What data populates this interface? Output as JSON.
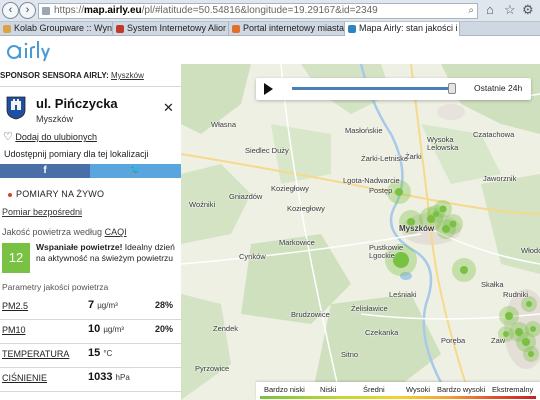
{
  "browser": {
    "url_domain": "map.airly.eu",
    "url_prefix": "https://",
    "url_rest": "/pl/#latitude=50.54816&longitude=19.29167&id=2349",
    "tabs": [
      {
        "label": "Kolab Groupware :: Wyniki wys...",
        "color": "#d9a441"
      },
      {
        "label": "System Internetowy Alior Bank...",
        "color": "#c0392b"
      },
      {
        "label": "Portal internetowy miasta Mys...",
        "color": "#e0702a"
      },
      {
        "label": "Mapa Airly: stan jakości i po...",
        "color": "#2e86c1"
      }
    ]
  },
  "header": {
    "sponsor_label": "SPONSOR SENSORA AIRLY:",
    "sponsor_name": "Myszków"
  },
  "location": {
    "street": "ul. Pińczycka",
    "town": "Myszków",
    "favorite_label": "Dodaj do ulubionych",
    "share_label": "Udostępnij pomiary dla tej lokalizacji",
    "facebook_label": "f",
    "twitter_label": "🐦"
  },
  "live": {
    "heading": "POMIARY NA ŻYWO",
    "direct_link": "Pomiar bezpośredni",
    "caqi_prefix": "Jakość powietrza według",
    "caqi_link": "CAQI",
    "caqi_value": "12",
    "caqi_color": "#79c142",
    "quality_title": "Wspaniałe powietrze!",
    "quality_desc": " Idealny dzień na aktywność na świeżym powietrzu",
    "params_label": "Parametry jakości powietrza"
  },
  "measurements": [
    {
      "name": "PM2.5",
      "value": "7",
      "unit": "µg/m³",
      "pct": "28%"
    },
    {
      "name": "PM10",
      "value": "10",
      "unit": "µg/m³",
      "pct": "20%"
    },
    {
      "name": "TEMPERATURA",
      "value": "15",
      "unit": "°C",
      "pct": ""
    },
    {
      "name": "CIŚNIENIE",
      "value": "1033",
      "unit": "hPa",
      "pct": ""
    }
  ],
  "player": {
    "time_label": "Ostatnie 24h"
  },
  "legend": [
    "Bardzo niski",
    "Niski",
    "Średni",
    "Wysoki",
    "Bardzo wysoki",
    "Ekstremalny"
  ],
  "map_labels": {
    "wlasna": "Własna",
    "czatachowa": "Czatachowa",
    "maslonskie": "Masłońskie",
    "wysoka": "Wysoka Lelowska",
    "siedlec": "Siedlec Duży",
    "zarki_l": "Żarki-Letnisko",
    "zarki": "Żarki",
    "jaworznik": "Jaworznik",
    "lgota": "Lgota-Nadwarcie",
    "postep": "Postęp",
    "koziegl": "Koziegłowy",
    "gniazdow": "Gniazdów",
    "wozniki": "Woźniki",
    "koziegl2": "Koziegłowy",
    "myszkow": "Myszków",
    "markowice": "Markowice",
    "pustkowie": "Pustkowie Lgockie",
    "cynkow": "Cynków",
    "wlodo": "Włodo",
    "skalka": "Skałka",
    "lesniaki": "Leśniaki",
    "rudniki": "Rudniki",
    "zelislawice": "Żelisławice",
    "brudzowice": "Brudzowice",
    "zendek": "Zendek",
    "czekanka": "Czekanka",
    "zaw": "Zaw",
    "poreba": "Poręba",
    "sitno": "Sitno",
    "pyrzowice": "Pyrzowice"
  }
}
